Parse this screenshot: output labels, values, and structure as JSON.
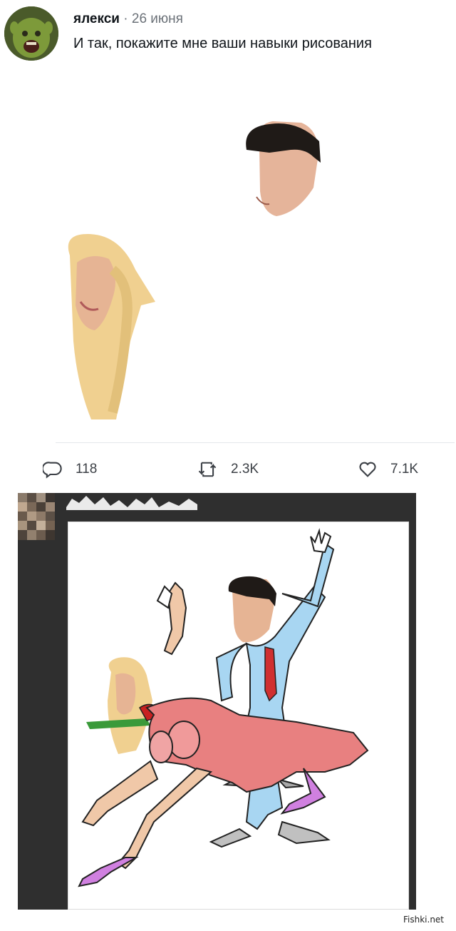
{
  "tweet": {
    "author": "ялекси",
    "separator": "·",
    "date": "26 июня",
    "text": "И так, покажите мне ваши навыки рисования",
    "avatar_icon": "shrek-avatar",
    "actions": {
      "reply_count": "118",
      "retweet_count": "2.3K",
      "like_count": "7.1K"
    }
  },
  "drawing_post": {
    "avatar_icon": "pixelated-avatar"
  },
  "watermark": "Fishki.net",
  "colors": {
    "text": "#0f1419",
    "muted": "#6b7178",
    "dark_frame": "#2f2f2f",
    "dress": "#e47a7a",
    "suit": "#9ed0f0",
    "shoe": "#c86ad0"
  }
}
